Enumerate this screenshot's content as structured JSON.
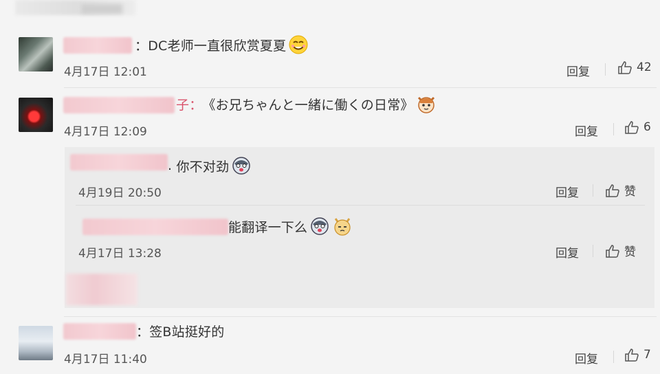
{
  "comments": [
    {
      "text": "DC老师一直很欣赏夏夏",
      "date": "4月17日 12:01",
      "reply_label": "回复",
      "likes": "42"
    },
    {
      "name_suffix": "子：",
      "text": "《お兄ちゃんと一緒に働くの日常》",
      "date": "4月17日 12:09",
      "reply_label": "回复",
      "likes": "6",
      "replies": [
        {
          "text": "你不对劲",
          "date": "4月19日 20:50",
          "reply_label": "回复",
          "like_label": "赞"
        },
        {
          "text": "能翻译一下么",
          "date": "4月17日 13:28",
          "reply_label": "回复",
          "like_label": "赞"
        }
      ]
    },
    {
      "text": "签B站挺好的",
      "date": "4月17日 11:40",
      "reply_label": "回复",
      "likes": "7"
    }
  ],
  "colors": {
    "name_pink": "#d9536b",
    "page_bg": "#f4f4f4",
    "reply_bg": "#ebebeb"
  },
  "icons": [
    "smile-emoji-icon",
    "cat-emoji-icon",
    "husky-emoji-icon",
    "doge-emoji-icon",
    "thumbs-up-icon"
  ]
}
